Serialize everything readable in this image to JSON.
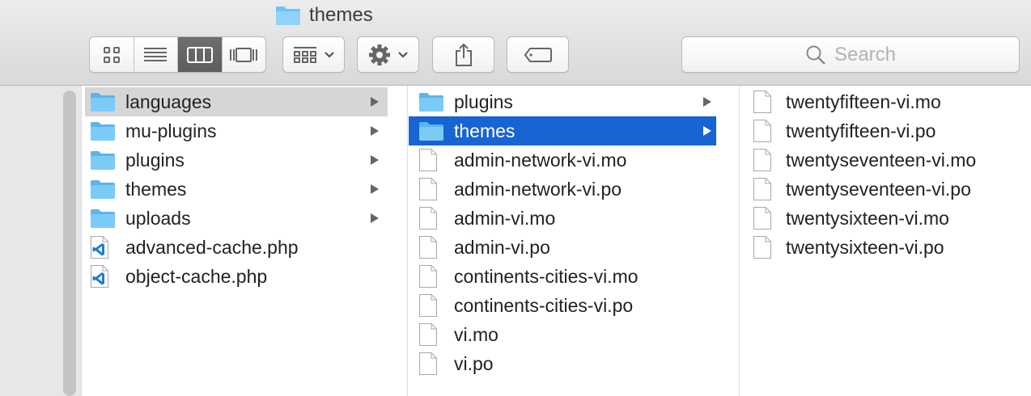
{
  "window": {
    "title": "themes",
    "title_icon": "folder-icon"
  },
  "toolbar": {
    "view_buttons": [
      {
        "name": "icon-view",
        "icon": "grid-icon",
        "active": false
      },
      {
        "name": "list-view",
        "icon": "list-icon",
        "active": false
      },
      {
        "name": "column-view",
        "icon": "columns-icon",
        "active": true
      },
      {
        "name": "gallery-view",
        "icon": "gallery-icon",
        "active": false
      }
    ],
    "group_button_icon": "group-by-icon",
    "action_button_icon": "gear-icon",
    "share_button_icon": "share-icon",
    "tag_button_icon": "tag-icon",
    "search": {
      "placeholder": "Search",
      "icon": "magnifier-icon"
    }
  },
  "colors": {
    "selection_blue": "#1764d2",
    "selection_gray": "#d6d6d6",
    "folder_blue": "#6cc3f5"
  },
  "columns": [
    {
      "items": [
        {
          "name": "languages",
          "type": "folder",
          "has_children": true,
          "selected": "gray"
        },
        {
          "name": "mu-plugins",
          "type": "folder",
          "has_children": true
        },
        {
          "name": "plugins",
          "type": "folder",
          "has_children": true
        },
        {
          "name": "themes",
          "type": "folder",
          "has_children": true
        },
        {
          "name": "uploads",
          "type": "folder",
          "has_children": true
        },
        {
          "name": "advanced-cache.php",
          "type": "code"
        },
        {
          "name": "object-cache.php",
          "type": "code"
        }
      ]
    },
    {
      "items": [
        {
          "name": "plugins",
          "type": "folder",
          "has_children": true
        },
        {
          "name": "themes",
          "type": "folder",
          "has_children": true,
          "selected": "blue"
        },
        {
          "name": "admin-network-vi.mo",
          "type": "file"
        },
        {
          "name": "admin-network-vi.po",
          "type": "file"
        },
        {
          "name": "admin-vi.mo",
          "type": "file"
        },
        {
          "name": "admin-vi.po",
          "type": "file"
        },
        {
          "name": "continents-cities-vi.mo",
          "type": "file"
        },
        {
          "name": "continents-cities-vi.po",
          "type": "file"
        },
        {
          "name": "vi.mo",
          "type": "file"
        },
        {
          "name": "vi.po",
          "type": "file"
        }
      ]
    },
    {
      "items": [
        {
          "name": "twentyfifteen-vi.mo",
          "type": "file"
        },
        {
          "name": "twentyfifteen-vi.po",
          "type": "file"
        },
        {
          "name": "twentyseventeen-vi.mo",
          "type": "file"
        },
        {
          "name": "twentyseventeen-vi.po",
          "type": "file"
        },
        {
          "name": "twentysixteen-vi.mo",
          "type": "file"
        },
        {
          "name": "twentysixteen-vi.po",
          "type": "file"
        }
      ]
    }
  ]
}
